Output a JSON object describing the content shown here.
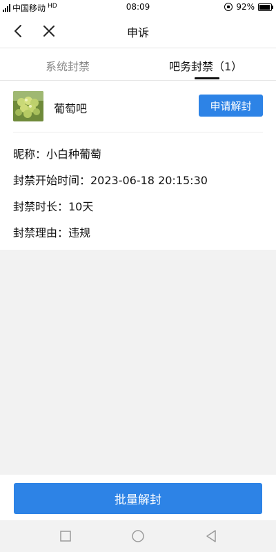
{
  "status_bar": {
    "carrier": "中国移动",
    "hd": "HD",
    "time": "08:09",
    "battery": "92%",
    "battery_level": 0.92
  },
  "nav": {
    "title": "申诉"
  },
  "tabs": [
    {
      "label": "系统封禁",
      "active": false
    },
    {
      "label": "吧务封禁（1）",
      "active": true
    }
  ],
  "ban_card": {
    "forum_name": "葡萄吧",
    "apply_label": "申请解封",
    "nickname": "昵称：小白种葡萄",
    "start_time": "封禁开始时间：2023-06-18 20:15:30",
    "duration": "封禁时长：10天",
    "reason": "封禁理由：违规"
  },
  "batch_button_label": "批量解封",
  "colors": {
    "primary_blue": "#2d83e6",
    "background": "#f2f2f2"
  },
  "icons": {
    "back": "chevron-left-icon",
    "close": "close-icon",
    "recent_apps": "square-icon",
    "home": "circle-icon",
    "system_back": "triangle-back-icon"
  }
}
